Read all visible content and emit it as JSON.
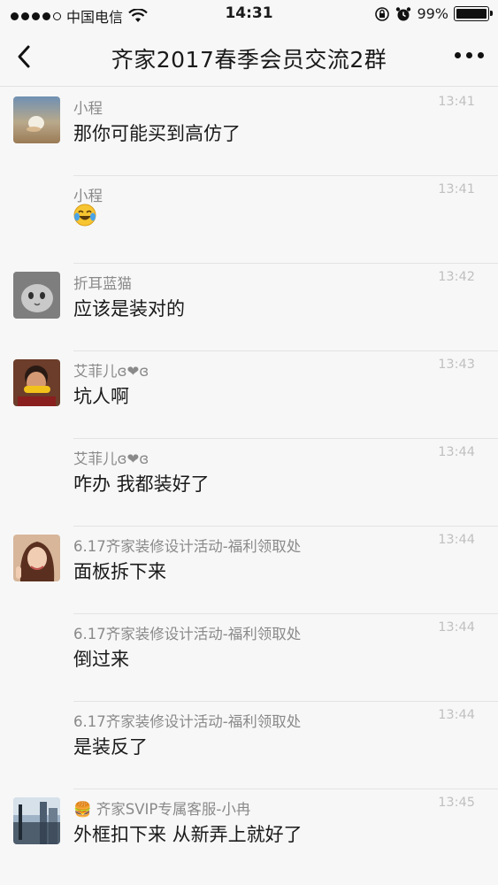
{
  "status_bar": {
    "carrier": "中国电信",
    "time": "14:31",
    "battery": "99%",
    "battery_level": 0.99,
    "signal_bars": 4,
    "signal_total": 5
  },
  "nav": {
    "title": "齐家2017春季会员交流2群",
    "back_icon": "chevron-left-icon",
    "more_icon": "more-dots-icon"
  },
  "messages": [
    {
      "sender": "小程",
      "time": "13:41",
      "text": "那你可能买到高仿了",
      "avatar": "cup-photo",
      "show_avatar": true
    },
    {
      "sender": "小程",
      "time": "13:41",
      "text": "",
      "emoji": "laughing-tears-emoji",
      "show_avatar": false
    },
    {
      "sender": "折耳蓝猫",
      "time": "13:42",
      "text": "应该是装对的",
      "avatar": "cat-photo",
      "show_avatar": true
    },
    {
      "sender": "艾菲儿ɞ❤ɞ",
      "time": "13:43",
      "text": "坑人啊",
      "avatar": "corn-photo",
      "show_avatar": true
    },
    {
      "sender": "艾菲儿ɞ❤ɞ",
      "time": "13:44",
      "text": "咋办 我都装好了",
      "show_avatar": false
    },
    {
      "sender": "6.17齐家装修设计活动-福利领取处",
      "time": "13:44",
      "text": "面板拆下来",
      "avatar": "woman-photo",
      "show_avatar": true
    },
    {
      "sender": "6.17齐家装修设计活动-福利领取处",
      "time": "13:44",
      "text": "倒过来",
      "show_avatar": false
    },
    {
      "sender": "6.17齐家装修设计活动-福利领取处",
      "time": "13:44",
      "text": "是装反了",
      "show_avatar": false
    },
    {
      "sender": "🍔 齐家SVIP专属客服-小冉",
      "time": "13:45",
      "text": "外框扣下来 从新弄上就好了",
      "avatar": "building-photo",
      "show_avatar": true
    }
  ]
}
